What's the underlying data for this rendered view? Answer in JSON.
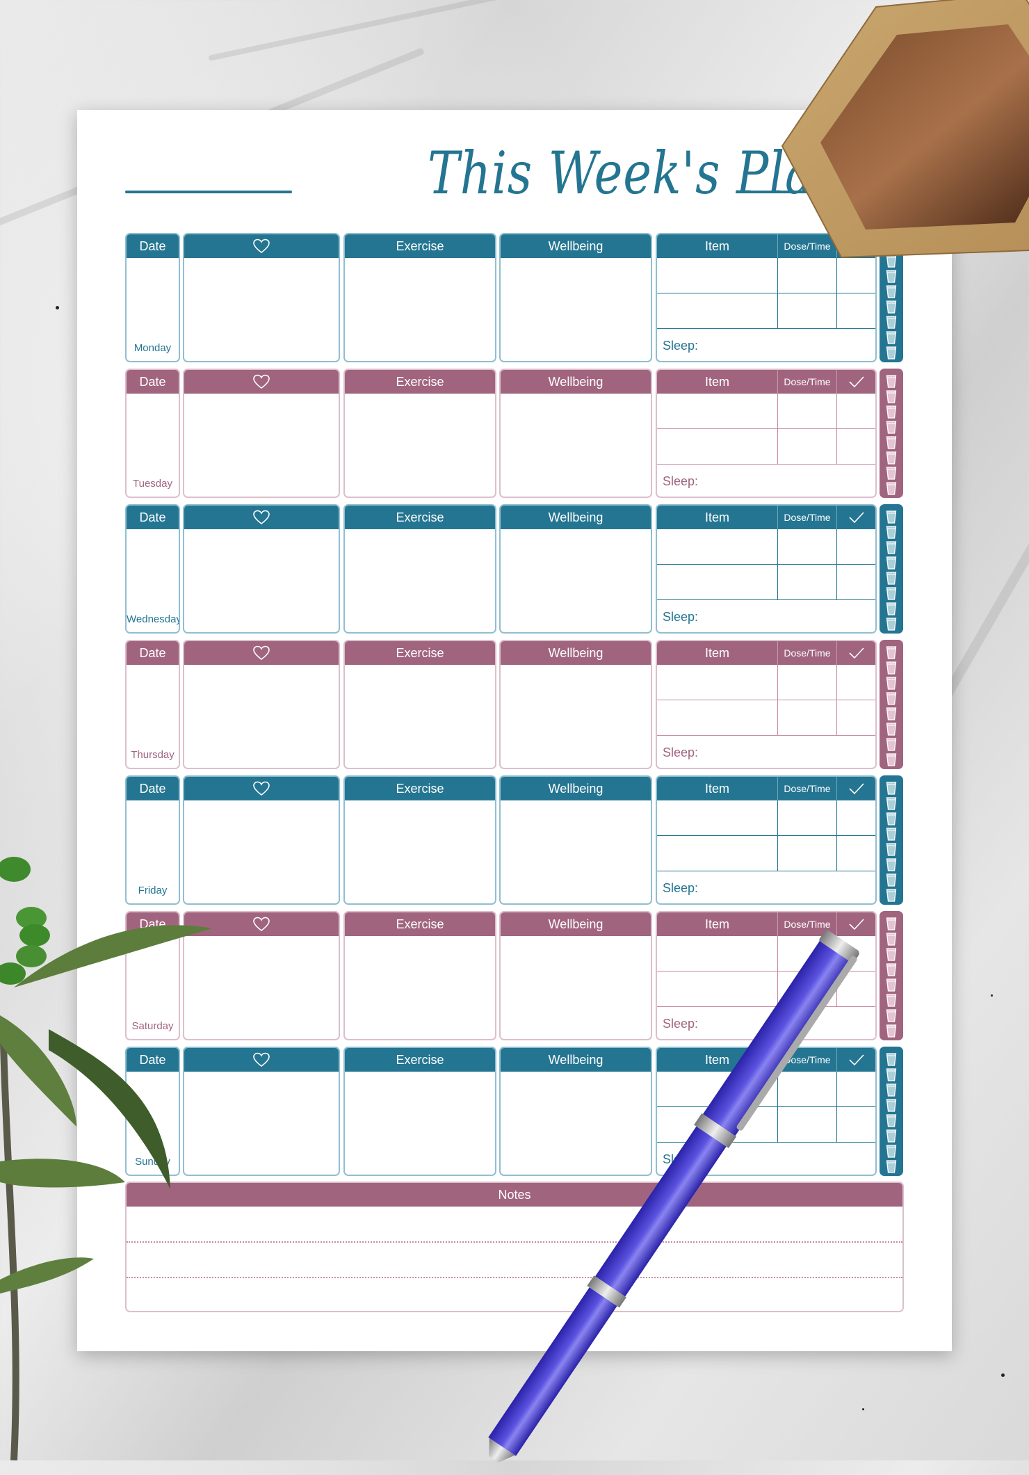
{
  "title": "This Week's Plan",
  "colors": {
    "teal": "#247591",
    "mauve": "#a1647f"
  },
  "headers": {
    "date": "Date",
    "mood_icon": "heart-icon",
    "exercise": "Exercise",
    "wellbeing": "Wellbeing",
    "item": "Item",
    "dose_time": "Dose/Time",
    "done_icon": "check-icon",
    "sleep": "Sleep:",
    "water_icon": "water-glass-icon"
  },
  "water_glasses_per_day": 8,
  "medication_rows_per_day": 2,
  "days": [
    {
      "name": "Monday",
      "theme": "teal"
    },
    {
      "name": "Tuesday",
      "theme": "mauve"
    },
    {
      "name": "Wednesday",
      "theme": "teal"
    },
    {
      "name": "Thursday",
      "theme": "mauve"
    },
    {
      "name": "Friday",
      "theme": "teal"
    },
    {
      "name": "Saturday",
      "theme": "mauve"
    },
    {
      "name": "Sunday",
      "theme": "teal"
    }
  ],
  "notes": {
    "label": "Notes",
    "lines": 3
  }
}
